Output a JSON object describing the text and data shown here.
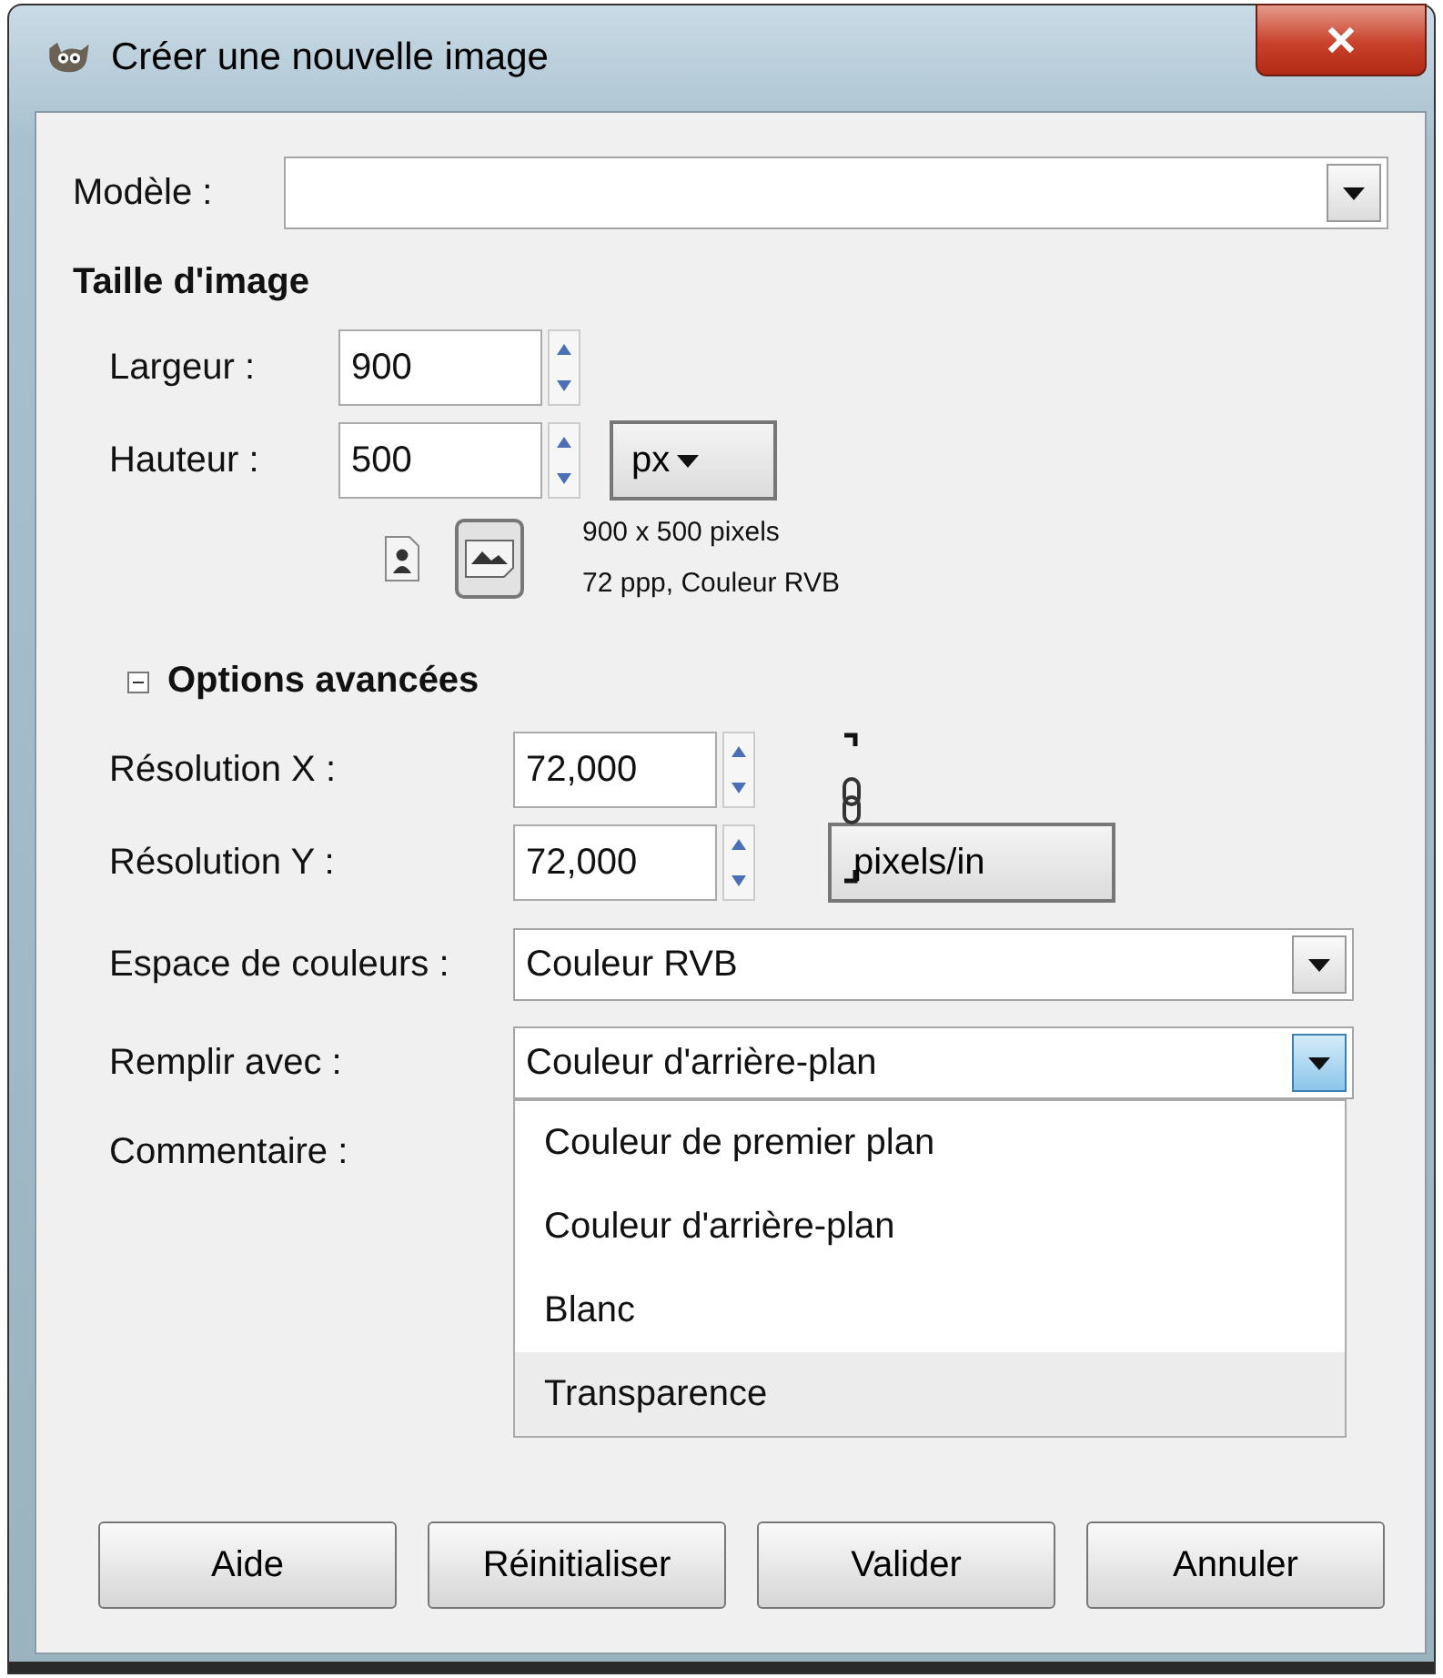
{
  "window": {
    "title": "Créer une nouvelle image"
  },
  "template": {
    "label": "Modèle :"
  },
  "image_size": {
    "heading": "Taille d'image",
    "width": {
      "label": "Largeur :",
      "value": "900"
    },
    "height": {
      "label": "Hauteur :",
      "value": "500"
    },
    "unit": "px",
    "orientations": [
      {
        "kind": "portrait",
        "selected": false
      },
      {
        "kind": "landscape",
        "selected": true
      }
    ],
    "info": [
      "900 x 500 pixels",
      "72 ppp, Couleur RVB"
    ]
  },
  "advanced": {
    "heading": "Options avancées",
    "expanded": true,
    "resolution_x": {
      "label": "Résolution X :",
      "value": "72,000"
    },
    "resolution_y": {
      "label": "Résolution Y :",
      "value": "72,000"
    },
    "chained": true,
    "resolution_unit": "pixels/in",
    "color_space": {
      "label": "Espace de couleurs :",
      "value": "Couleur RVB"
    },
    "fill": {
      "label": "Remplir avec :",
      "value": "Couleur d'arrière-plan",
      "open": true,
      "options": [
        {
          "label": "Couleur de premier plan",
          "highlighted": false
        },
        {
          "label": "Couleur d'arrière-plan",
          "highlighted": false
        },
        {
          "label": "Blanc",
          "highlighted": false
        },
        {
          "label": "Transparence",
          "highlighted": true
        }
      ]
    },
    "comment": {
      "label": "Commentaire :"
    }
  },
  "buttons": [
    "Aide",
    "Réinitialiser",
    "Valider",
    "Annuler"
  ]
}
